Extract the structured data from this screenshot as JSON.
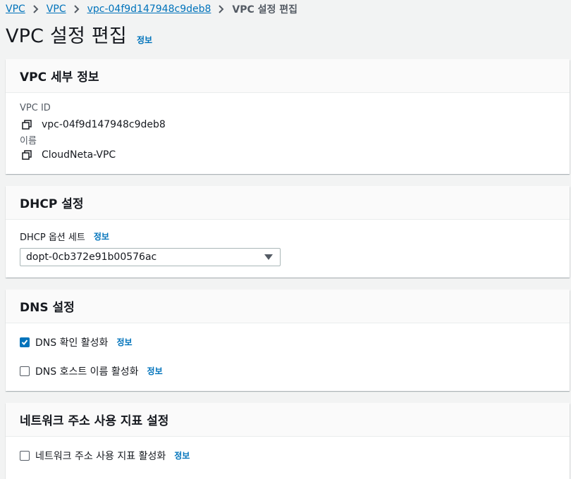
{
  "breadcrumb": {
    "items": [
      "VPC",
      "VPC",
      "vpc-04f9d147948c9deb8"
    ],
    "current": "VPC 설정 편집"
  },
  "page": {
    "title": "VPC 설정 편집",
    "info": "정보"
  },
  "vpc_details": {
    "heading": "VPC 세부 정보",
    "id_label": "VPC ID",
    "id_value": "vpc-04f9d147948c9deb8",
    "name_label": "이름",
    "name_value": "CloudNeta-VPC"
  },
  "dhcp": {
    "heading": "DHCP 설정",
    "field_label": "DHCP 옵션 세트",
    "info": "정보",
    "selected": "dopt-0cb372e91b00576ac"
  },
  "dns": {
    "heading": "DNS 설정",
    "resolution_label": "DNS 확인 활성화",
    "resolution_checked": true,
    "hostnames_label": "DNS 호스트 이름 활성화",
    "hostnames_checked": false,
    "info": "정보"
  },
  "network_usage": {
    "heading": "네트워크 주소 사용 지표 설정",
    "checkbox_label": "네트워크 주소 사용 지표 활성화",
    "checked": false,
    "info": "정보"
  },
  "colors": {
    "link": "#0073bb",
    "checkbox_checked": "#0073bb",
    "panel_header": "#fafafa",
    "background": "#f2f3f3"
  }
}
